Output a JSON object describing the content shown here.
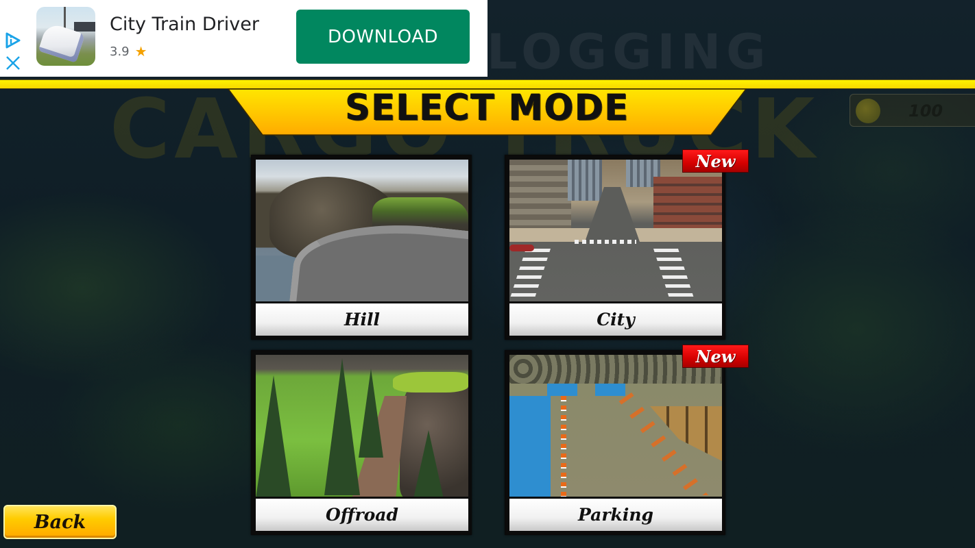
{
  "ad": {
    "app_name": "City Train Driver",
    "rating": "3.9",
    "star_icon": "★",
    "cta_label": "DOWNLOAD",
    "info_icon": "adchoices-icon",
    "close_icon": "close-icon",
    "colors": {
      "cta_bg": "#01875f",
      "icon_accent": "#1aa3e8",
      "star": "#f4a100"
    }
  },
  "background": {
    "logo_text": "CARGO TRUCK",
    "logo_text_top": "LOGGING"
  },
  "header": {
    "title": "SELECT MODE",
    "colors": {
      "stripe": "#fff200",
      "panel_top": "#ffe000",
      "panel_bottom": "#ffae00"
    }
  },
  "coins": {
    "value": "100",
    "icon": "coin-icon"
  },
  "modes": [
    {
      "label": "Hill",
      "is_new": false
    },
    {
      "label": "City",
      "is_new": true,
      "badge": "New"
    },
    {
      "label": "Offroad",
      "is_new": false
    },
    {
      "label": "Parking",
      "is_new": true,
      "badge": "New"
    }
  ],
  "back_button": {
    "label": "Back"
  }
}
